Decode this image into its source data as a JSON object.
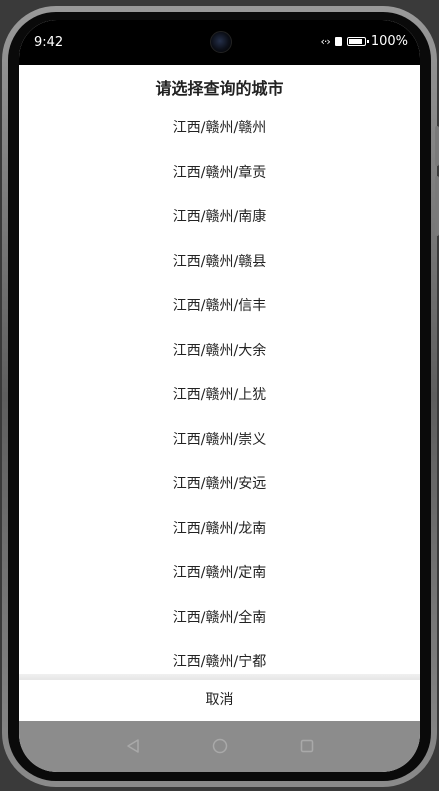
{
  "status_bar": {
    "time": "9:42",
    "battery_percent": "100%",
    "battery_level": 1.0,
    "signal_icon": "sync-arrows-icon",
    "lock_icon": "lock-icon",
    "battery_icon": "battery-icon"
  },
  "dialog": {
    "title": "请选择查询的城市",
    "cities": [
      "江西/赣州/赣州",
      "江西/赣州/章贡",
      "江西/赣州/南康",
      "江西/赣州/赣县",
      "江西/赣州/信丰",
      "江西/赣州/大余",
      "江西/赣州/上犹",
      "江西/赣州/崇义",
      "江西/赣州/安远",
      "江西/赣州/龙南",
      "江西/赣州/定南",
      "江西/赣州/全南",
      "江西/赣州/宁都"
    ],
    "cancel_label": "取消"
  },
  "nav_bar": {
    "back_icon": "back-triangle-icon",
    "home_icon": "home-circle-icon",
    "recents_icon": "recents-square-icon"
  },
  "colors": {
    "dialog_background": "#ffffff",
    "text": "#222222",
    "nav_bar": "#8c8c8c",
    "status_bar": "#000000"
  }
}
